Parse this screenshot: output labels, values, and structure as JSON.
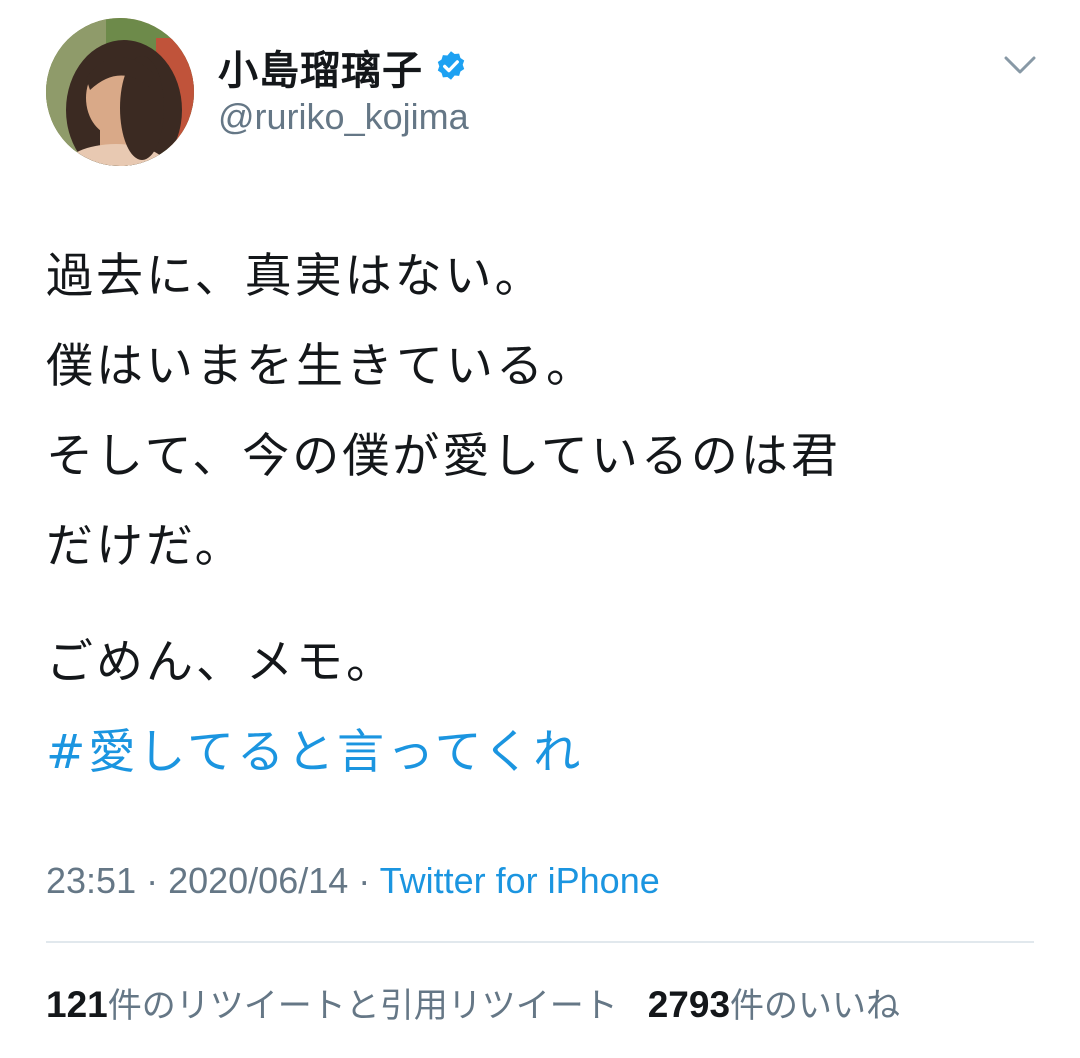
{
  "user": {
    "display_name": "小島瑠璃子",
    "handle": "@ruriko_kojima",
    "verified": true
  },
  "tweet": {
    "lines": [
      "過去に、真実はない。",
      "僕はいまを生きている。",
      "そして、今の僕が愛しているのは君",
      "だけだ。"
    ],
    "line_after_gap": "ごめん、メモ。",
    "hashtag": "#愛してると言ってくれ"
  },
  "meta": {
    "time": "23:51",
    "separator": " · ",
    "date": "2020/06/14",
    "source": "Twitter for iPhone"
  },
  "stats": {
    "retweets_count": "121",
    "retweets_label": "件のリツイートと引用リツイート",
    "likes_count": "2793",
    "likes_label": "件のいいね"
  },
  "icons": {
    "verified": "verified-badge-icon",
    "menu": "chevron-down-icon"
  },
  "colors": {
    "link": "#1b95e0",
    "secondary_text": "#657786",
    "primary_text": "#14171a",
    "verified": "#1da1f2"
  }
}
